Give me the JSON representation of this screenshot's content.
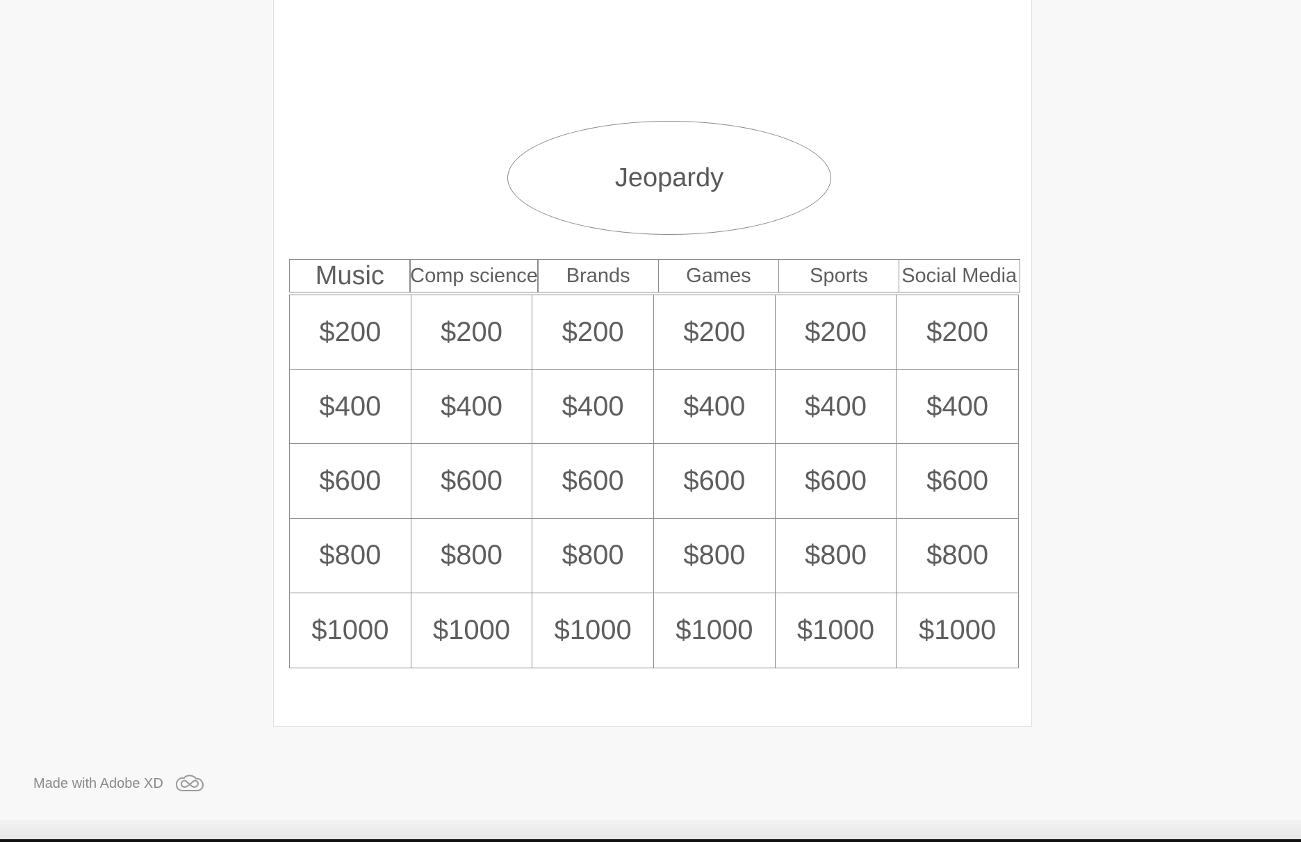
{
  "title": "Jeopardy",
  "categories": [
    "Music",
    "Comp science",
    "Brands",
    "Games",
    "Sports",
    "Social Media"
  ],
  "rows": [
    [
      "$200",
      "$200",
      "$200",
      "$200",
      "$200",
      "$200"
    ],
    [
      "$400",
      "$400",
      "$400",
      "$400",
      "$400",
      "$400"
    ],
    [
      "$600",
      "$600",
      "$600",
      "$600",
      "$600",
      "$600"
    ],
    [
      "$800",
      "$800",
      "$800",
      "$800",
      "$800",
      "$800"
    ],
    [
      "$1000",
      "$1000",
      "$1000",
      "$1000",
      "$1000",
      "$1000"
    ]
  ],
  "footer": {
    "label": "Made with Adobe XD",
    "icon": "creative-cloud-icon"
  },
  "colors": {
    "background": "#f8f8f8",
    "artboard": "#ffffff",
    "text": "#5e5e5e",
    "border": "#8c8c8c"
  }
}
